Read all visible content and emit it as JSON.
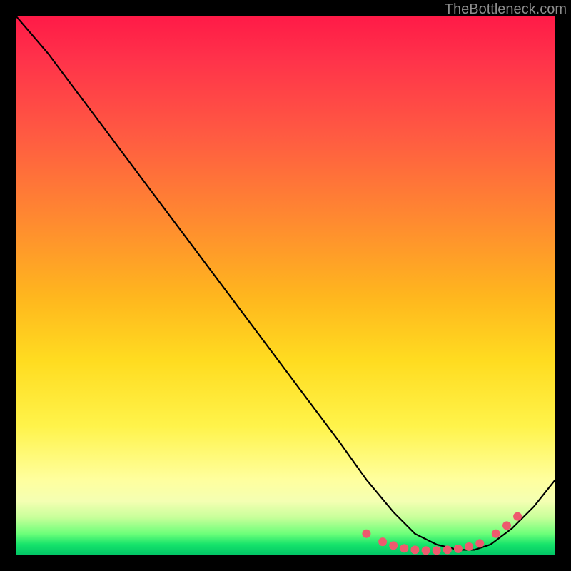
{
  "watermark": "TheBottleneck.com",
  "chart_data": {
    "type": "line",
    "title": "",
    "xlabel": "",
    "ylabel": "",
    "xlim": [
      0,
      100
    ],
    "ylim": [
      0,
      100
    ],
    "grid": false,
    "series": [
      {
        "name": "curve",
        "color": "#000000",
        "x": [
          0,
          6,
          12,
          18,
          24,
          30,
          36,
          42,
          48,
          54,
          60,
          65,
          70,
          74,
          78,
          82,
          85,
          88,
          92,
          96,
          100
        ],
        "y": [
          100,
          93,
          85,
          77,
          69,
          61,
          53,
          45,
          37,
          29,
          21,
          14,
          8,
          4,
          2,
          1,
          1,
          2,
          5,
          9,
          14
        ]
      }
    ],
    "dots": {
      "color": "#ee5a6e",
      "radius": 6,
      "points": [
        {
          "x": 65,
          "y": 4.0
        },
        {
          "x": 68,
          "y": 2.5
        },
        {
          "x": 70,
          "y": 1.8
        },
        {
          "x": 72,
          "y": 1.3
        },
        {
          "x": 74,
          "y": 1.0
        },
        {
          "x": 76,
          "y": 0.9
        },
        {
          "x": 78,
          "y": 0.9
        },
        {
          "x": 80,
          "y": 1.0
        },
        {
          "x": 82,
          "y": 1.2
        },
        {
          "x": 84,
          "y": 1.6
        },
        {
          "x": 86,
          "y": 2.2
        },
        {
          "x": 89,
          "y": 4.0
        },
        {
          "x": 91,
          "y": 5.5
        },
        {
          "x": 93,
          "y": 7.2
        }
      ]
    }
  }
}
